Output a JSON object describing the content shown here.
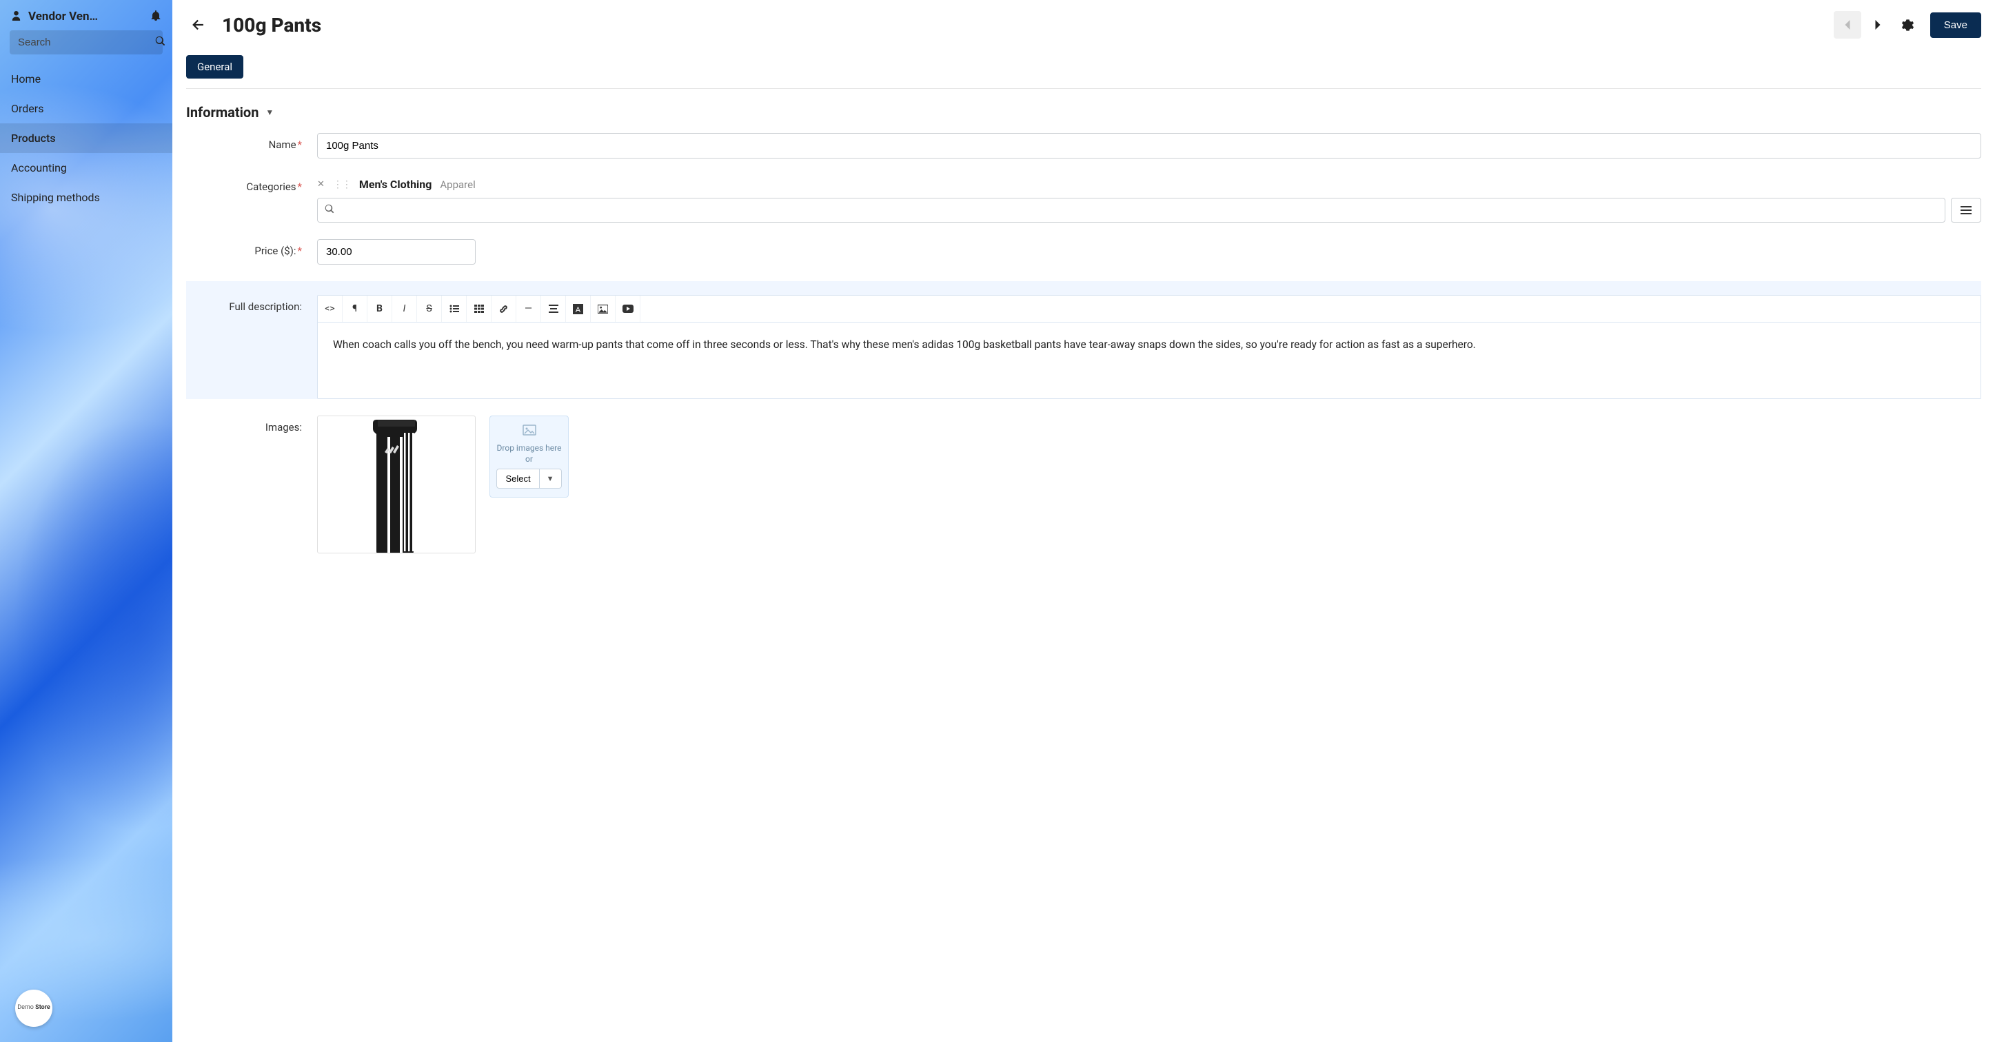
{
  "sidebar": {
    "vendor_label": "Vendor Ven…",
    "search_placeholder": "Search",
    "nav": [
      {
        "label": "Home",
        "active": false
      },
      {
        "label": "Orders",
        "active": false
      },
      {
        "label": "Products",
        "active": true
      },
      {
        "label": "Accounting",
        "active": false
      },
      {
        "label": "Shipping methods",
        "active": false
      }
    ],
    "badge_line1": "Demo",
    "badge_line2": "Store"
  },
  "header": {
    "title": "100g Pants",
    "save_label": "Save"
  },
  "tabs": {
    "general": "General"
  },
  "section": {
    "information": "Information"
  },
  "form": {
    "name_label": "Name",
    "name_value": "100g Pants",
    "categories_label": "Categories",
    "category_main": "Men's Clothing",
    "category_parent": "Apparel",
    "price_label": "Price ($):",
    "price_value": "30.00",
    "desc_label": "Full description:",
    "desc_text": "When coach calls you off the bench, you need warm-up pants that come off in three seconds or less. That's why these men's adidas 100g basketball pants have tear-away snaps down the sides, so you're ready for action as fast as a superhero.",
    "images_label": "Images:",
    "drop_text": "Drop images here or",
    "select_label": "Select"
  },
  "colors": {
    "primary": "#0a2c52",
    "required": "#d9534f"
  }
}
